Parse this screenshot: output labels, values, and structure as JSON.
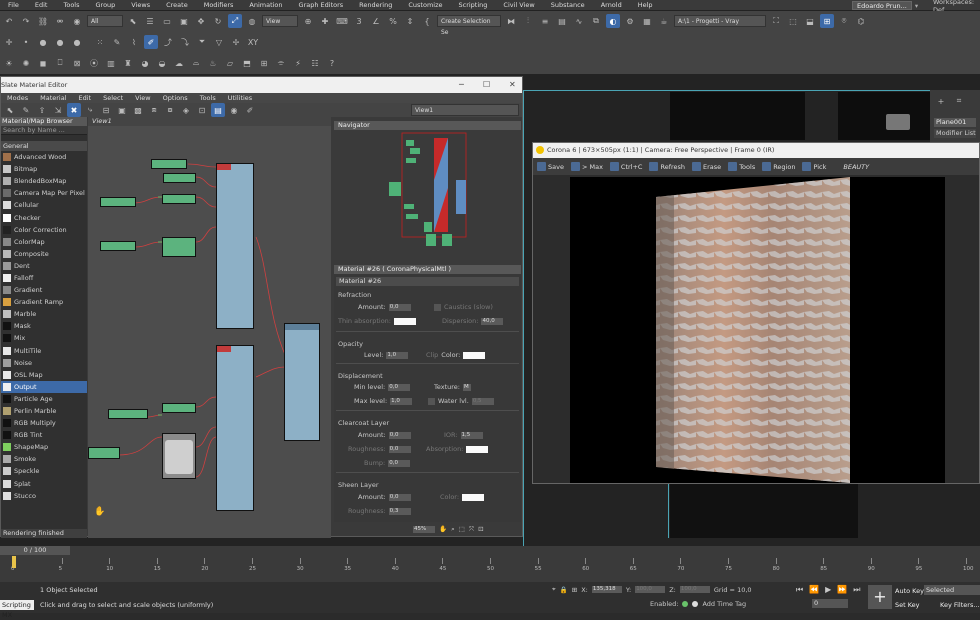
{
  "menu": [
    "File",
    "Edit",
    "Tools",
    "Group",
    "Views",
    "Create",
    "Modifiers",
    "Animation",
    "Graph Editors",
    "Rendering",
    "Customize",
    "Scripting",
    "Civil View",
    "Substance",
    "Arnold",
    "Help"
  ],
  "user": "Edoardo Prun...",
  "workspaces_label": "Workspaces: Def",
  "toolbar": {
    "filter_value": "All",
    "view_value": "View",
    "selection_set_placeholder": "Create Selection Se",
    "project_value": "A:\\1 - Progetti - Vray"
  },
  "command_panel": {
    "object_name": "Plane001",
    "modifier_list": "Modifier List"
  },
  "sme": {
    "title": "Slate Material Editor",
    "menu": [
      "Modes",
      "Material",
      "Edit",
      "Select",
      "View",
      "Options",
      "Tools",
      "Utilities"
    ],
    "view_dropdown": "View1",
    "browser_title": "Material/Map Browser",
    "search_placeholder": "Search by Name ...",
    "group": "General",
    "maps": [
      {
        "name": "Advanced Wood",
        "color": "#a0704a"
      },
      {
        "name": "Bitmap",
        "color": "#c8c8c8"
      },
      {
        "name": "BlendedBoxMap",
        "color": "#b0b0b0"
      },
      {
        "name": "Camera Map Per Pixel",
        "color": "#6a6a6a"
      },
      {
        "name": "Cellular",
        "color": "#dedede"
      },
      {
        "name": "Checker",
        "color": "#ffffff"
      },
      {
        "name": "Color Correction",
        "color": "#222222"
      },
      {
        "name": "ColorMap",
        "color": "#888888"
      },
      {
        "name": "Composite",
        "color": "#b8b8b8"
      },
      {
        "name": "Dent",
        "color": "#9a9a9a"
      },
      {
        "name": "Falloff",
        "color": "#f0f0f0"
      },
      {
        "name": "Gradient",
        "color": "#8a8a8a"
      },
      {
        "name": "Gradient Ramp",
        "color": "#d8a040"
      },
      {
        "name": "Marble",
        "color": "#c0c0c0"
      },
      {
        "name": "Mask",
        "color": "#111111"
      },
      {
        "name": "Mix",
        "color": "#111111"
      },
      {
        "name": "MultiTile",
        "color": "#e8e8e8"
      },
      {
        "name": "Noise",
        "color": "#9e9e9e"
      },
      {
        "name": "OSL Map",
        "color": "#e8e8e8"
      },
      {
        "name": "Output",
        "color": "#f0f0f0"
      },
      {
        "name": "Particle Age",
        "color": "#111111"
      },
      {
        "name": "Perlin Marble",
        "color": "#b0a070"
      },
      {
        "name": "RGB Multiply",
        "color": "#111111"
      },
      {
        "name": "RGB Tint",
        "color": "#111111"
      },
      {
        "name": "ShapeMap",
        "color": "#7fcf5f"
      },
      {
        "name": "Smoke",
        "color": "#aaaaaa"
      },
      {
        "name": "Speckle",
        "color": "#cccccc"
      },
      {
        "name": "Splat",
        "color": "#dddddd"
      },
      {
        "name": "Stucco",
        "color": "#e0e0e0"
      }
    ],
    "selected_map": "Output",
    "view_tab": "View1",
    "navigator_title": "Navigator",
    "props_title": "Material #26  ( CoronaPhysicalMtl )",
    "material_name": "Material #26",
    "refraction": {
      "title": "Refraction",
      "amount_label": "Amount:",
      "amount": "0,0",
      "caustics": "Caustics (slow)",
      "thin_abs": "Thin absorption:",
      "dispersion_label": "Dispersion:",
      "dispersion": "40,0"
    },
    "opacity": {
      "title": "Opacity",
      "level_label": "Level:",
      "level": "1,0",
      "clip": "Clip",
      "color_label": "Color:"
    },
    "displacement": {
      "title": "Displacement",
      "min_label": "Min level:",
      "min": "0,0",
      "texture_label": "Texture:",
      "texture": "M",
      "max_label": "Max level:",
      "max": "1,0",
      "water_label": "Water lvl.",
      "water": "0,5"
    },
    "clearcoat": {
      "title": "Clearcoat Layer",
      "amount_label": "Amount:",
      "amount": "0,0",
      "ior_label": "IOR:",
      "ior": "1,5",
      "rough_label": "Roughness:",
      "rough": "0,0",
      "absorb_label": "Absorption:",
      "bump_label": "Bump:",
      "bump": "0,0"
    },
    "sheen": {
      "title": "Sheen Layer",
      "amount_label": "Amount:",
      "amount": "0,0",
      "color_label": "Color:",
      "rough_label": "Roughness:",
      "rough": "0,3"
    },
    "status": "Rendering finished",
    "zoom": "45%"
  },
  "corona": {
    "title": "Corona 6 | 673×505px (1:1) | Camera: Free Perspective | Frame 0 (IR)",
    "toolbar": [
      "Save",
      "> Max",
      "Ctrl+C",
      "Refresh",
      "Erase",
      "Tools",
      "Region",
      "Pick"
    ],
    "pass": "BEAUTY"
  },
  "timeline": {
    "frame": "0 / 100",
    "ticks": [
      "0",
      "5",
      "10",
      "15",
      "20",
      "25",
      "30",
      "35",
      "40",
      "45",
      "50",
      "55",
      "60",
      "65",
      "70",
      "75",
      "80",
      "85",
      "90",
      "95",
      "100"
    ]
  },
  "status": {
    "script": "Scripting MX",
    "selected": "1 Object Selected",
    "hint": "Click and drag to select and scale objects (uniformly)",
    "x": "135,318",
    "y": "100,0",
    "z": "100,0",
    "grid": "Grid = 10,0",
    "enabled": "Enabled:",
    "add_time_tag": "Add Time Tag",
    "auto_key": "Auto Key",
    "selected_dd": "Selected",
    "set_key": "Set Key",
    "key_filters": "Key Filters...",
    "frame_field": "0"
  }
}
